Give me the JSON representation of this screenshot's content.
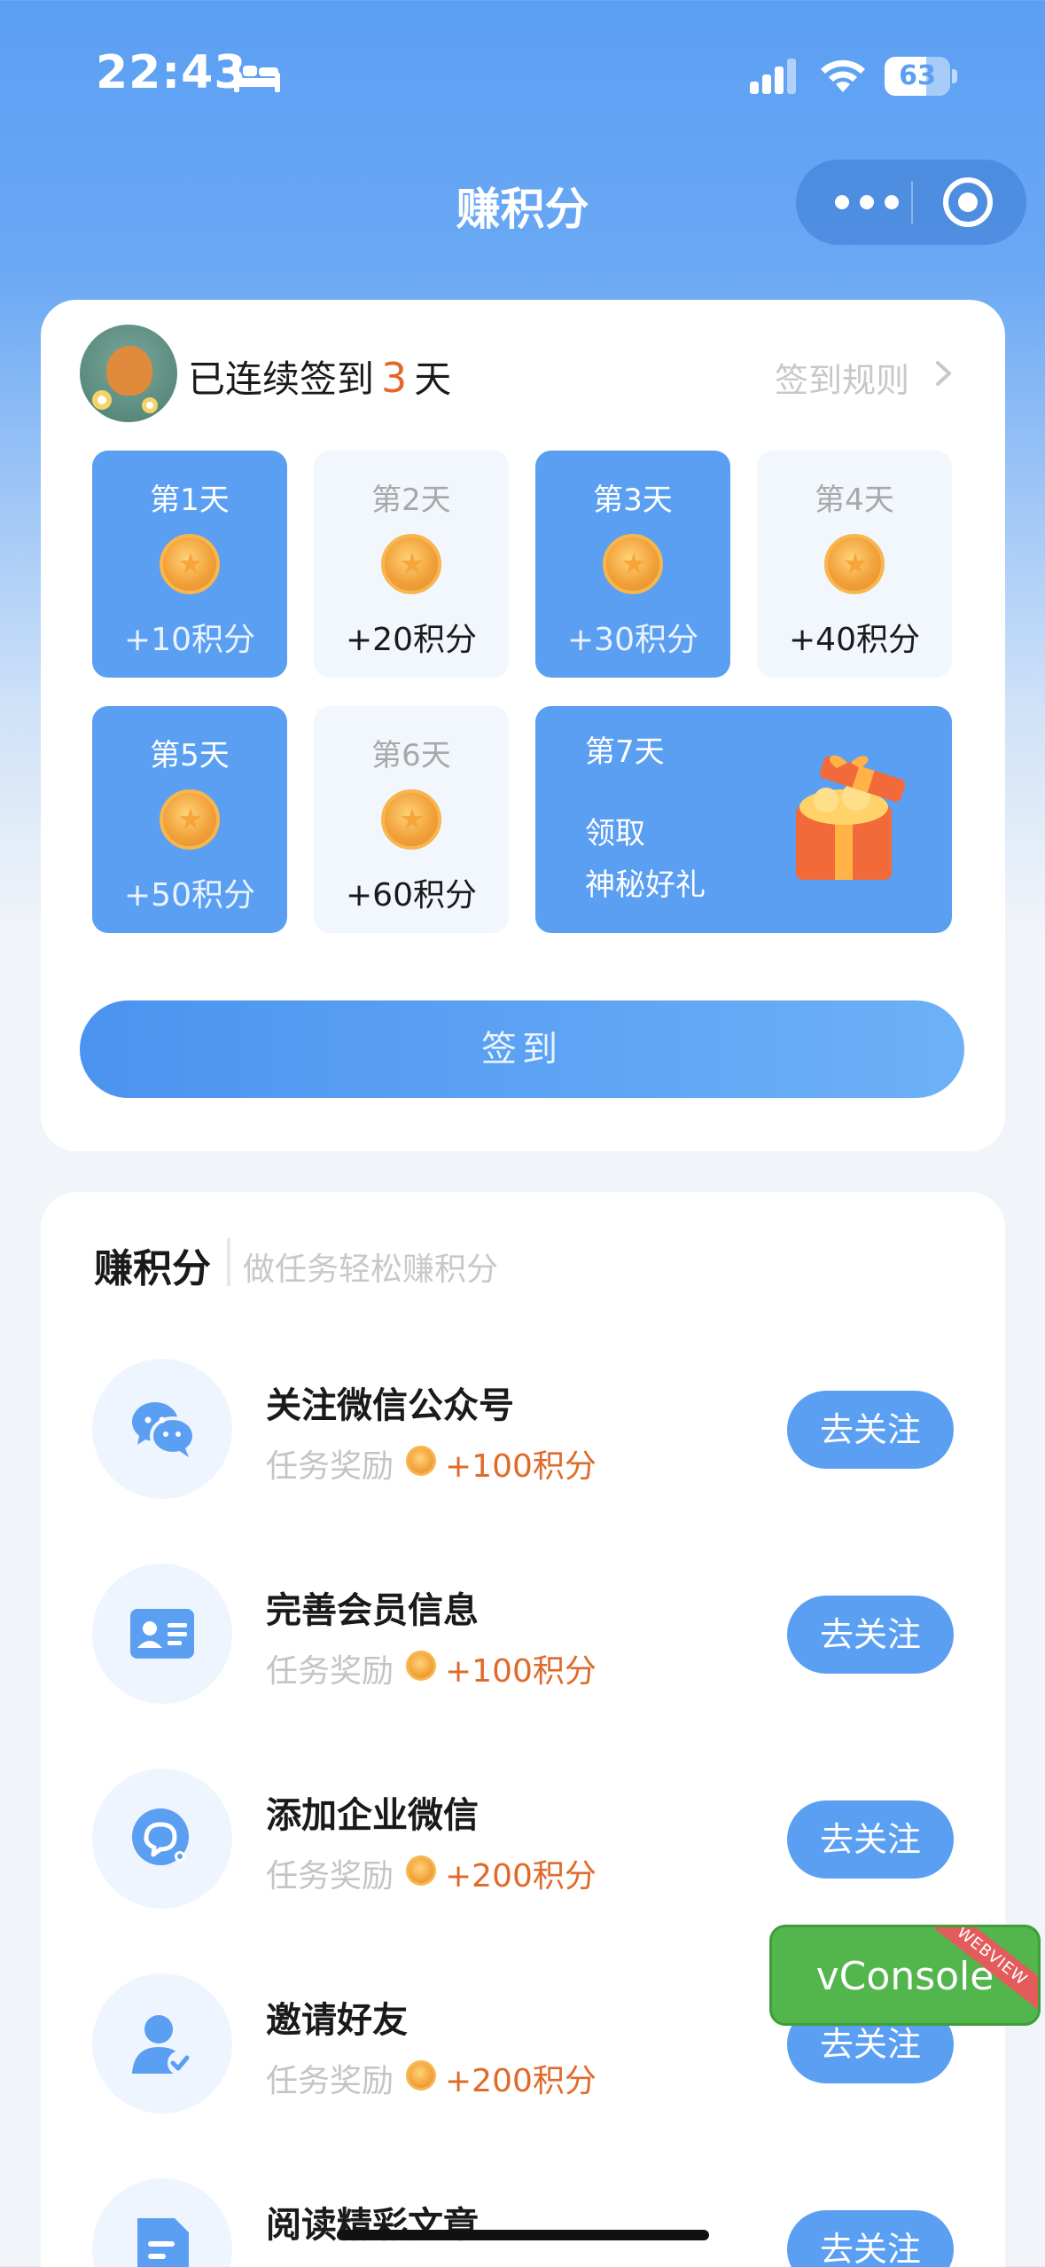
{
  "status_bar": {
    "time": "22:43",
    "battery": "63",
    "battery_level": 0.63
  },
  "nav": {
    "title": "赚积分"
  },
  "checkin": {
    "streak_prefix": "已连续签到",
    "streak_days": "3",
    "streak_suffix": "天",
    "rules_label": "签到规则",
    "days": [
      {
        "label": "第1天",
        "points": "+10积分",
        "checked": true
      },
      {
        "label": "第2天",
        "points": "+20积分",
        "checked": false
      },
      {
        "label": "第3天",
        "points": "+30积分",
        "checked": true
      },
      {
        "label": "第4天",
        "points": "+40积分",
        "checked": false
      },
      {
        "label": "第5天",
        "points": "+50积分",
        "checked": true
      },
      {
        "label": "第6天",
        "points": "+60积分",
        "checked": false
      }
    ],
    "day7": {
      "label": "第7天",
      "line1": "领取",
      "line2": "神秘好礼"
    },
    "sign_button": "签到"
  },
  "tasks": {
    "title": "赚积分",
    "subtitle": "做任务轻松赚积分",
    "reward_label": "任务奖励",
    "items": [
      {
        "name": "关注微信公众号",
        "points": "+100积分",
        "button": "去关注",
        "icon": "wechat-icon"
      },
      {
        "name": "完善会员信息",
        "points": "+100积分",
        "button": "去关注",
        "icon": "id-card-icon"
      },
      {
        "name": "添加企业微信",
        "points": "+200积分",
        "button": "去关注",
        "icon": "work-wechat-icon"
      },
      {
        "name": "邀请好友",
        "points": "+200积分",
        "button": "去关注",
        "icon": "invite-user-icon"
      },
      {
        "name": "阅读精彩文章",
        "points": "",
        "button": "去关注",
        "icon": "article-icon"
      }
    ]
  },
  "vconsole": {
    "label": "vConsole",
    "ribbon": "WEBVIEW"
  },
  "colors": {
    "primary": "#5b9ff3",
    "accent": "#e06a2a"
  }
}
